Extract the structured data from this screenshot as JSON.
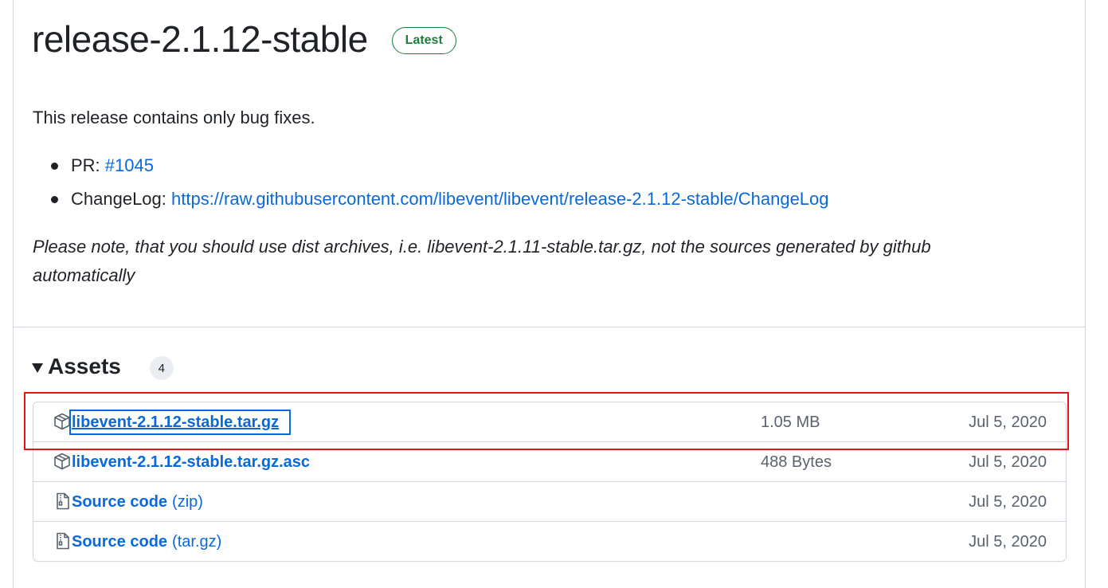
{
  "release": {
    "title": "release-2.1.12-stable",
    "badge": "Latest",
    "description": "This release contains only bug fixes.",
    "bullets": [
      {
        "label": "PR: ",
        "link_text": "#1045"
      },
      {
        "label": "ChangeLog: ",
        "link_text": "https://raw.githubusercontent.com/libevent/libevent/release-2.1.12-stable/ChangeLog"
      }
    ],
    "note": "Please note, that you should use dist archives, i.e. libevent-2.1.11-stable.tar.gz, not the sources generated by github automatically"
  },
  "assets": {
    "title": "Assets",
    "count": "4",
    "items": [
      {
        "name": "libevent-2.1.12-stable.tar.gz",
        "suffix": "",
        "size": "1.05 MB",
        "date": "Jul 5, 2020",
        "icon": "package-icon"
      },
      {
        "name": "libevent-2.1.12-stable.tar.gz.asc",
        "suffix": "",
        "size": "488 Bytes",
        "date": "Jul 5, 2020",
        "icon": "package-icon"
      },
      {
        "name": "Source code",
        "suffix": "(zip)",
        "size": "",
        "date": "Jul 5, 2020",
        "icon": "file-zip-icon"
      },
      {
        "name": "Source code",
        "suffix": "(tar.gz)",
        "size": "",
        "date": "Jul 5, 2020",
        "icon": "file-zip-icon"
      }
    ]
  },
  "colors": {
    "link": "#0969da",
    "latest_badge": "#1a7f37",
    "highlight_box": "#e5141b"
  }
}
